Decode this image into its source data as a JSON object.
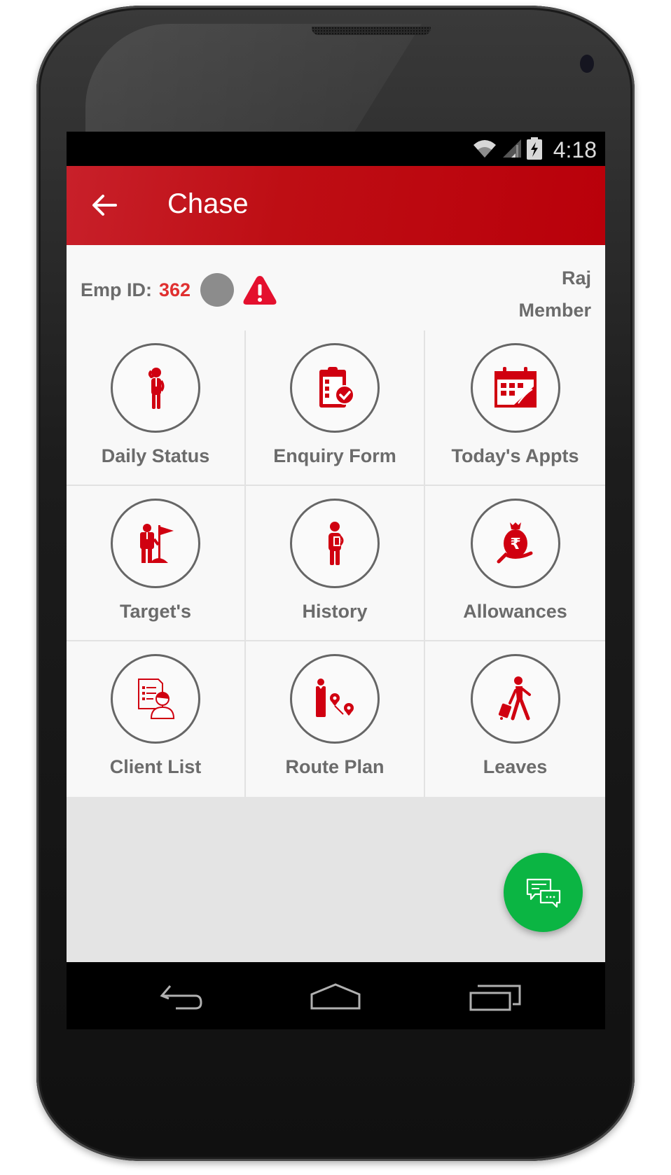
{
  "status_bar": {
    "time": "4:18",
    "icons": [
      "wifi-icon",
      "signal-icon",
      "battery-charging-icon"
    ]
  },
  "app_bar": {
    "back_icon": "arrow-left-icon",
    "title": "Chase"
  },
  "header": {
    "emp_label": "Emp ID:",
    "emp_id": "362",
    "status_dot_color": "#8c8c8c",
    "alert_icon": "warning-icon",
    "user_name": "Raj",
    "user_role": "Member"
  },
  "menu": {
    "items": [
      {
        "label": "Daily Status",
        "icon": "person-salute-icon"
      },
      {
        "label": "Enquiry Form",
        "icon": "clipboard-check-icon"
      },
      {
        "label": "Today's Appts",
        "icon": "calendar-icon"
      },
      {
        "label": "Target's",
        "icon": "person-flag-icon"
      },
      {
        "label": "History",
        "icon": "person-document-icon"
      },
      {
        "label": "Allowances",
        "icon": "money-bag-rupee-icon"
      },
      {
        "label": "Client List",
        "icon": "client-list-icon"
      },
      {
        "label": "Route Plan",
        "icon": "route-pin-icon"
      },
      {
        "label": "Leaves",
        "icon": "traveler-luggage-icon"
      }
    ]
  },
  "fab": {
    "icon": "chat-bubbles-icon",
    "color": "#0bb543"
  },
  "nav_bar": {
    "buttons": [
      "back-icon",
      "home-icon",
      "recents-icon"
    ]
  },
  "colors": {
    "accent": "#be0e14",
    "icon_red": "#d00010",
    "label_gray": "#6b6b6b"
  }
}
